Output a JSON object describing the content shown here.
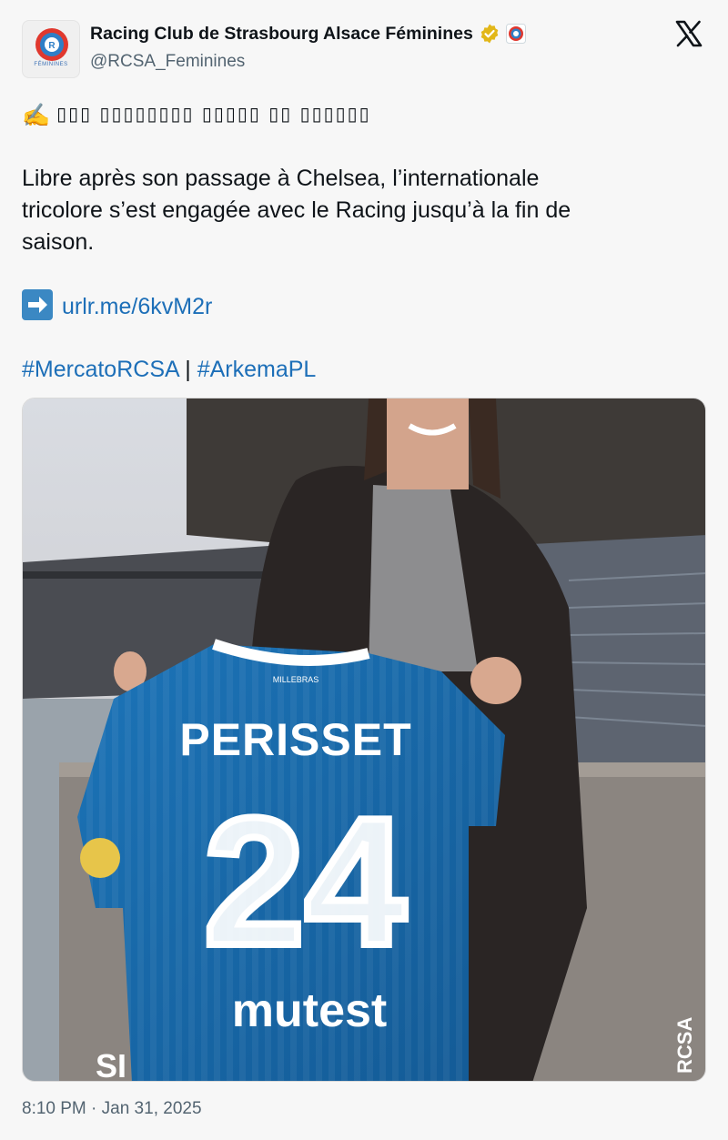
{
  "author": {
    "display_name": "Racing Club de Strasbourg Alsace Féminines",
    "handle": "@RCSA_Feminines",
    "avatar_caption": "FÉMININES"
  },
  "tweet": {
    "headline_emoji": "✍️",
    "headline_boxes": "▯▯▯ ▯▯▯▯▯▯▯▯ ▯▯▯▯▯ ▯▯ ▯▯▯▯▯▯",
    "body_line_1": "Libre après son passage à Chelsea, l’internationale",
    "body_line_2": "tricolore s’est engagée avec le Racing jusqu’à la fin de",
    "body_line_3": "saison.",
    "link": "urlr.me/6kvM2r",
    "hashtag_1": "#MercatoRCSA",
    "separator": "|",
    "hashtag_2": "#ArkemaPL"
  },
  "jersey": {
    "name": "PERISSET",
    "number": "24",
    "sponsor": "mutest",
    "brand": "MILLEBRAS",
    "watermark": "RCSA",
    "sleeve_fragment": "SI"
  },
  "timestamp": "8:10 PM · Jan 31, 2025",
  "colors": {
    "jersey_blue": "#1767a7",
    "link_blue": "#1d6fb8",
    "verified_gold": "#e2b719"
  }
}
